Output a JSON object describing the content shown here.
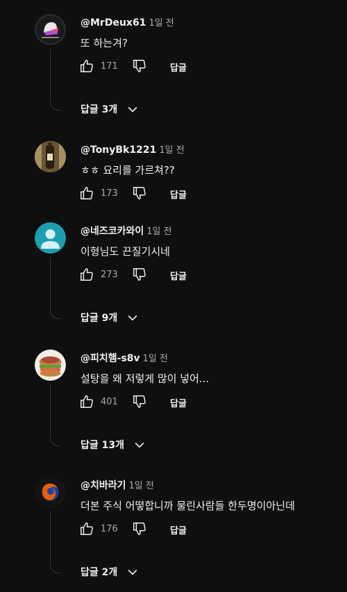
{
  "comments": [
    {
      "author": "@MrDeux61",
      "time": "1일 전",
      "text": "또  하는겨?",
      "likes": "171",
      "reply_label": "답글",
      "replies_label": "답글 3개"
    },
    {
      "author": "@TonyBk1221",
      "time": "1일 전",
      "text": "ㅎㅎ 요리를 가르쳐??",
      "likes": "173",
      "reply_label": "답글"
    },
    {
      "author": "@네즈코카와이",
      "time": "1일 전",
      "text": "이형님도 끈질기시네",
      "likes": "273",
      "reply_label": "답글",
      "replies_label": "답글 9개"
    },
    {
      "author": "@피치햄-s8v",
      "time": "1일 전",
      "text": "설탕을 왜 저렇게 많이 넣어...",
      "likes": "401",
      "reply_label": "답글",
      "replies_label": "답글 13개"
    },
    {
      "author": "@치바라기",
      "time": "1일 전",
      "text": "더본 주식 어떻합니까 물린사람들 한두명이아닌데",
      "likes": "176",
      "reply_label": "답글",
      "replies_label": "답글 2개"
    }
  ],
  "avatar_colors": {
    "default_avatar": "#1d9eb0",
    "firefox_orange": "#e66000",
    "firefox_blue": "#1f3fa8"
  }
}
